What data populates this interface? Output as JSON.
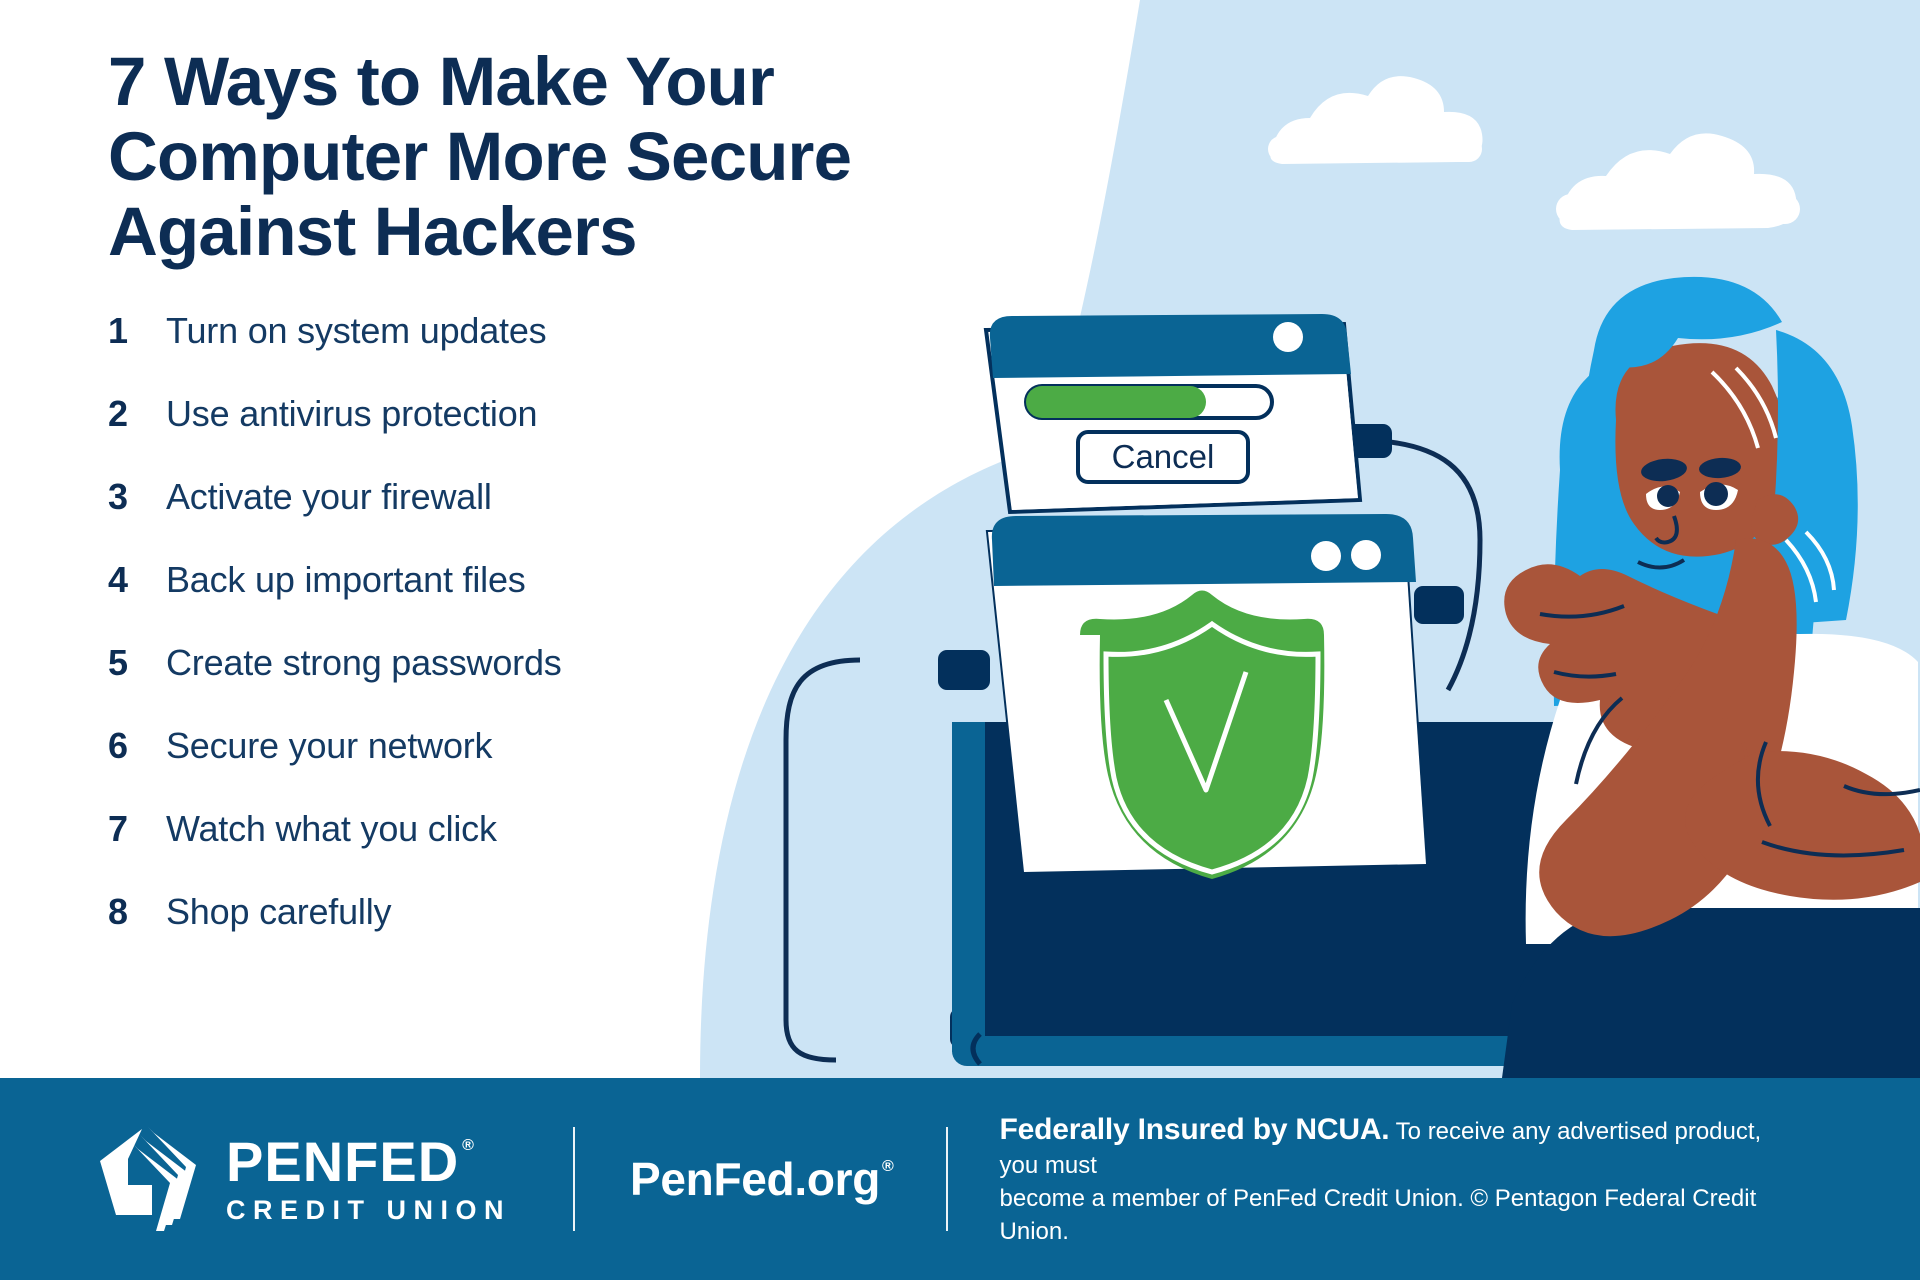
{
  "colors": {
    "navy": "#0d2d54",
    "deep_navy": "#03305c",
    "teal": "#0a6494",
    "footer_blue": "#0a6494",
    "sky_blue": "#cce4f5",
    "green": "#4cab45",
    "hair_blue": "#1ea2e2",
    "skin": "#a9553a",
    "white": "#ffffff"
  },
  "headline": {
    "line1": "7 Ways to Make Your",
    "line2": "Computer More Secure",
    "line3": "Against Hackers"
  },
  "tips": [
    {
      "num": "1",
      "text": "Turn on system updates"
    },
    {
      "num": "2",
      "text": "Use antivirus protection"
    },
    {
      "num": "3",
      "text": "Activate your firewall"
    },
    {
      "num": "4",
      "text": "Back up important files"
    },
    {
      "num": "5",
      "text": "Create strong passwords"
    },
    {
      "num": "6",
      "text": "Secure your network"
    },
    {
      "num": "7",
      "text": "Watch what you click"
    },
    {
      "num": "8",
      "text": "Shop carefully"
    }
  ],
  "illustration": {
    "progress_window": {
      "icon": "window-icon",
      "progress_percent": 73,
      "cancel_label": "Cancel",
      "titlebar_dots": 1
    },
    "shield_window": {
      "icon": "shield-check-icon",
      "titlebar_dots": 2
    },
    "laptop": {
      "icon": "laptop-icon"
    },
    "person": {
      "icon": "person-thinking-icon"
    },
    "clouds": [
      "cloud-icon",
      "cloud-icon"
    ]
  },
  "footer": {
    "logo": {
      "mark": "penfed-pentagon-logo-icon",
      "wordmark": "PENFED",
      "wordmark_reg": "®",
      "tagline": "CREDIT UNION"
    },
    "site": {
      "label": "PenFed.org",
      "reg": "®"
    },
    "disclaimer": {
      "bold": "Federally Insured by NCUA.",
      "line1_rest": " To receive any advertised product, you must",
      "line2": "become a member of PenFed Credit Union. © Pentagon Federal Credit Union."
    }
  }
}
